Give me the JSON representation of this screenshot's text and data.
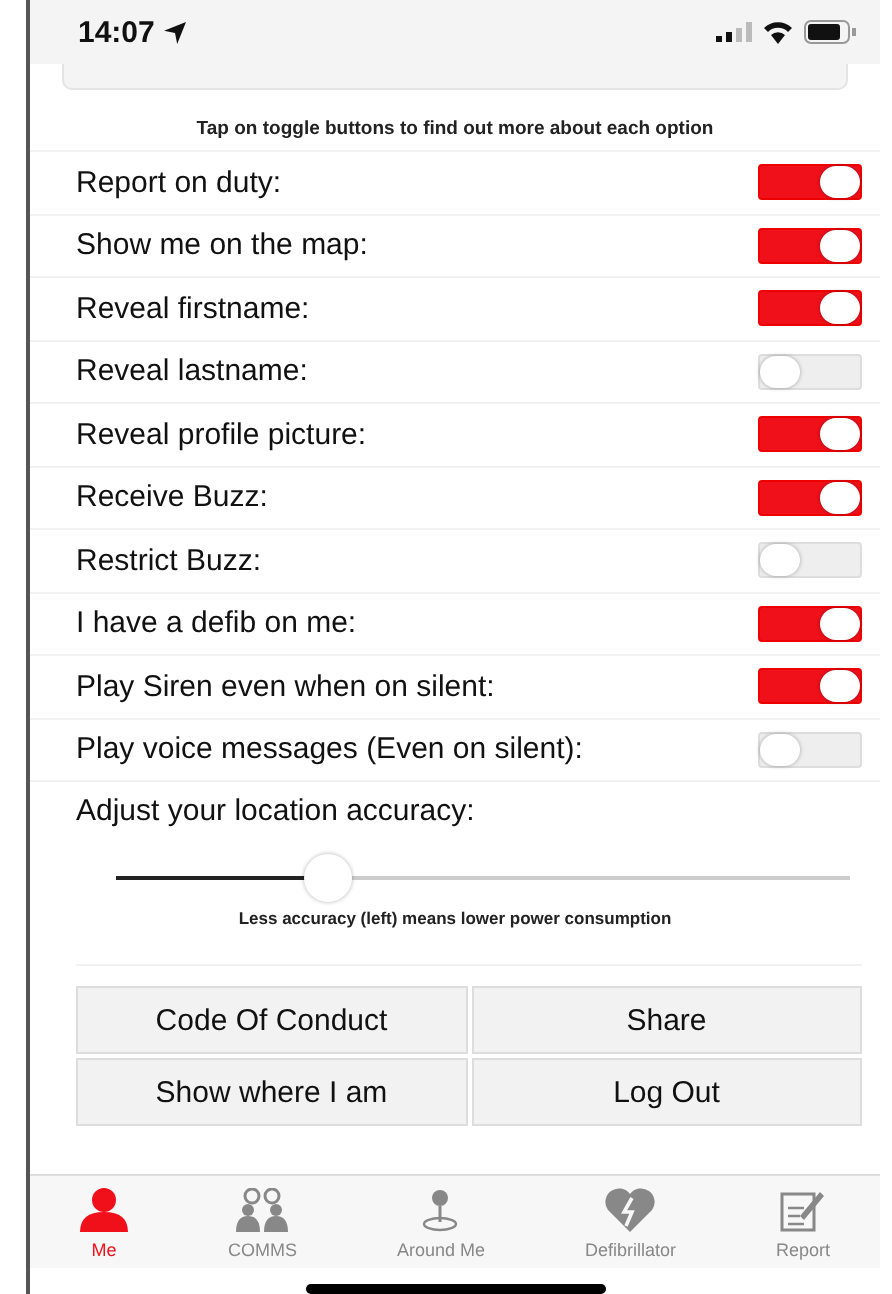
{
  "status_bar": {
    "time": "14:07"
  },
  "hint": "Tap on toggle buttons to find out more about each option",
  "settings": [
    {
      "label": "Report on duty:",
      "on": true
    },
    {
      "label": "Show me on the map:",
      "on": true
    },
    {
      "label": "Reveal firstname:",
      "on": true
    },
    {
      "label": "Reveal lastname:",
      "on": false
    },
    {
      "label": "Reveal profile picture:",
      "on": true
    },
    {
      "label": "Receive Buzz:",
      "on": true
    },
    {
      "label": "Restrict Buzz:",
      "on": false
    },
    {
      "label": "I have a defib on me:",
      "on": true
    },
    {
      "label": "Play Siren even when on silent:",
      "on": true
    },
    {
      "label": "Play voice messages (Even on silent):",
      "on": false
    }
  ],
  "accuracy": {
    "label": "Adjust your location accuracy:",
    "level": 0.29,
    "note": "Less accuracy (left) means lower power consumption"
  },
  "buttons": [
    "Code Of Conduct",
    "Share",
    "Show where I am",
    "Log Out"
  ],
  "tabs": [
    {
      "label": "Me",
      "kind": "person",
      "selected": true
    },
    {
      "label": "COMMS",
      "kind": "group",
      "selected": false
    },
    {
      "label": "Around Me",
      "kind": "pin",
      "selected": false
    },
    {
      "label": "Defibrillator",
      "kind": "heart",
      "selected": false
    },
    {
      "label": "Report",
      "kind": "report",
      "selected": false
    }
  ]
}
